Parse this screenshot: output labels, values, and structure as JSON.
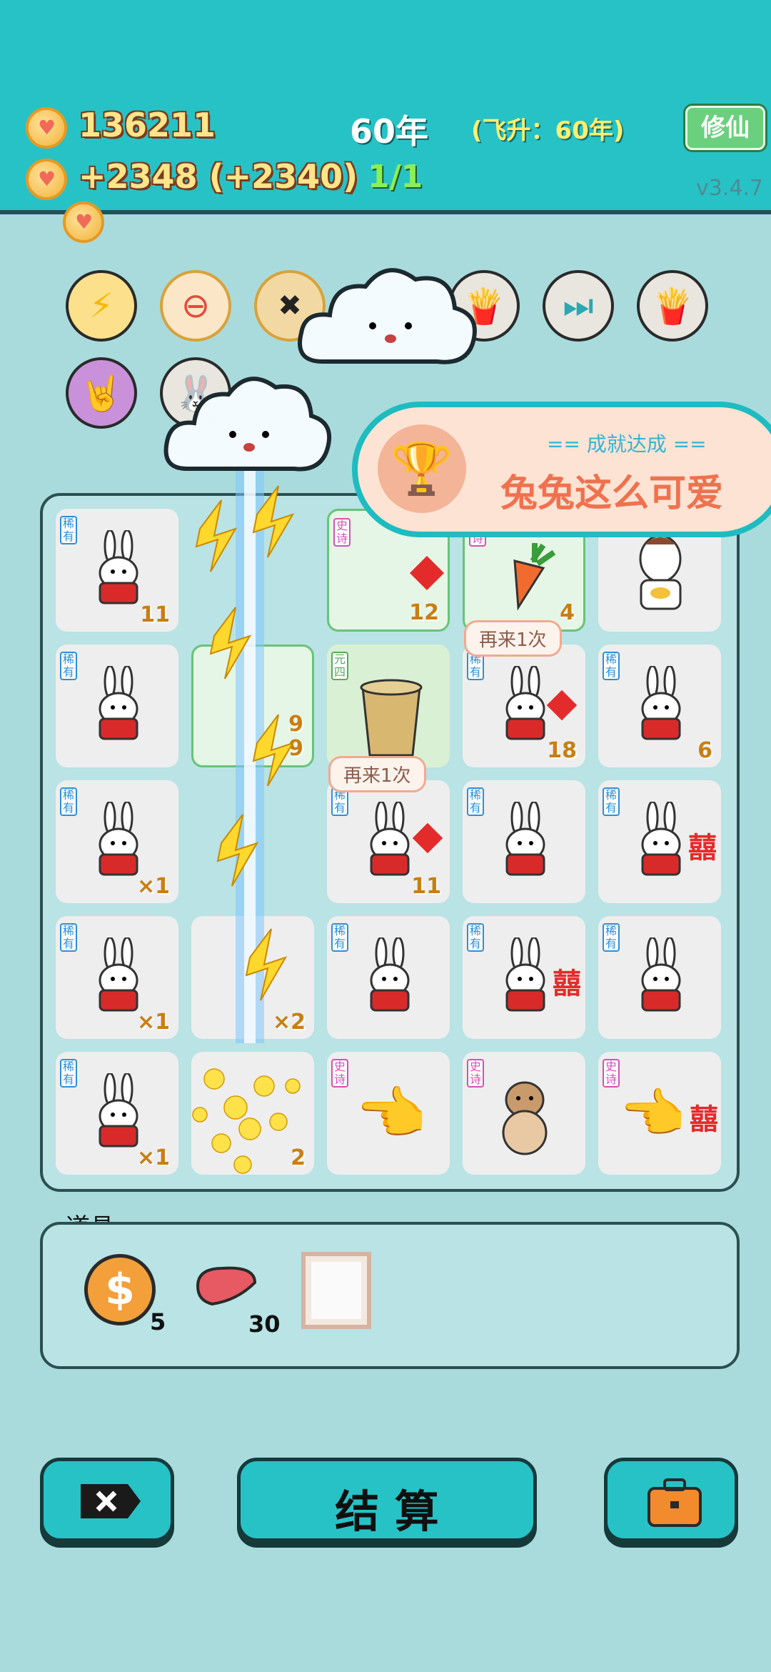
{
  "header": {
    "coins": "136211",
    "income": "+2348 (+2340)",
    "year": "60年",
    "ascension": "(飞升：60年)",
    "progress": "1/1",
    "xiuxian_button": "修仙",
    "version": "v3.4.7"
  },
  "achievement": {
    "title": "== 成就达成 ==",
    "name": "兔兔这么可爱"
  },
  "bubbles": {
    "again1": "再来1次",
    "again2": "再来1次"
  },
  "board": {
    "tags": {
      "rare": "稀有",
      "epic": "史诗",
      "yuan": "元四"
    },
    "numbers": [
      "11",
      "12",
      "4",
      "18",
      "6",
      "9",
      "2",
      "9",
      "×1",
      "11",
      "×1",
      "×2",
      "×1",
      "2"
    ]
  },
  "props": {
    "title": "道具",
    "coin_count": "5",
    "liver_count": "30"
  },
  "buttons": {
    "settle": "结 算"
  },
  "colors": {
    "teal": "#27c2c6",
    "board_bg": "#b9e3e4",
    "gold": "#ffe58a"
  }
}
